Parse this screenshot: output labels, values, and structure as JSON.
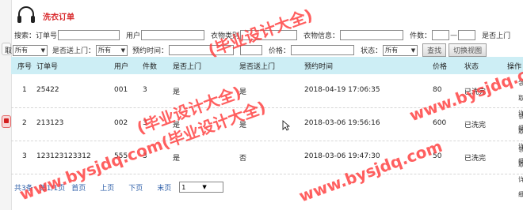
{
  "header": {
    "title": "洗衣订单"
  },
  "search": {
    "row1": {
      "prefix": "搜索：订单号",
      "user_label": "用户",
      "clothes_type_label": "衣物类别",
      "clothes_info_label": "衣物信息：",
      "pieces_label": "件数：",
      "pickup_label": "是否上门"
    },
    "row2": {
      "pickup_prefix": "取",
      "pickup_value": "所有",
      "delivery_label": "是否送上门：",
      "delivery_value": "所有",
      "appointment_label": "预约时间：",
      "price_label": "价格：",
      "status_label": "状态：",
      "status_value": "所有",
      "search_button": "查找",
      "switch_view_button": "切换视图"
    }
  },
  "table": {
    "columns": [
      "序号",
      "订单号",
      "用户",
      "件数",
      "是否上门",
      "是否送上门",
      "预约时间",
      "价格",
      "状态",
      "操作"
    ],
    "rows": [
      {
        "no": "1",
        "order": "25422",
        "user": "001",
        "qty": "3",
        "pickup": "是",
        "delivery": "是",
        "time": "2018-04-19 17:06:35",
        "price": "80",
        "status": "已洗完",
        "op1": "领取",
        "op2": "详细"
      },
      {
        "no": "2",
        "order": "213123",
        "user": "002",
        "qty": "3",
        "pickup": "是",
        "delivery": "是",
        "time": "2018-03-06 19:56:16",
        "price": "600",
        "status": "已洗完",
        "op1": "领取",
        "op2": "详细"
      },
      {
        "no": "3",
        "order": "123123123312",
        "user": "555",
        "qty": "3",
        "pickup": "是",
        "delivery": "否",
        "time": "2018-03-06 19:47:30",
        "price": "50",
        "status": "已洗完",
        "op1": "领取",
        "op2": "详细"
      }
    ]
  },
  "pager": {
    "total": "共3条",
    "page_info": "第1/1页",
    "first": "首页",
    "prev": "上页",
    "next": "下页",
    "last": "末页",
    "page_select": "1"
  },
  "watermarks": [
    "(毕业设计大全)",
    "(毕业设计大全)",
    "www.bysjdq.com(毕业设计",
    "www.bysjdq.com(毕业设计大全)",
    "www.bysjdq.com"
  ],
  "colors": {
    "title": "#d8282b",
    "header_bg": "#cdeef5",
    "watermark": "#ff3d3d",
    "link": "#2c5ea8"
  }
}
